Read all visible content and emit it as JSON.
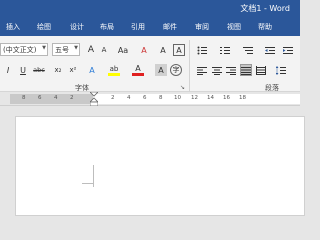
{
  "window": {
    "title": "文档1 - Word"
  },
  "tabs": [
    "插入",
    "绘图",
    "设计",
    "布局",
    "引用",
    "邮件",
    "审阅",
    "视图",
    "帮助"
  ],
  "font_group": {
    "font_name": "(中文正文)",
    "font_size": "五号",
    "grow_icon": "A",
    "shrink_icon": "A",
    "case_icon": "Aa",
    "clear_format_icon": "A",
    "phonetic_icon": "A",
    "border_icon": "A",
    "italic": "I",
    "underline": "U",
    "strike": "abc",
    "subscript": "x₂",
    "superscript": "x²",
    "effects_icon": "A",
    "highlight_icon": "ab",
    "font_color_icon": "A",
    "shade_icon": "A",
    "circle_icon": "字",
    "label": "字体",
    "launcher": "↘"
  },
  "paragraph_group": {
    "label": "段落"
  },
  "ruler": {
    "ticks": [
      "8",
      "6",
      "4",
      "2",
      "2",
      "4",
      "6",
      "8",
      "10",
      "12",
      "14",
      "16",
      "18"
    ]
  },
  "colors": {
    "brand": "#2b579a",
    "highlight": "#ffff00",
    "font_color": "#e02020"
  }
}
